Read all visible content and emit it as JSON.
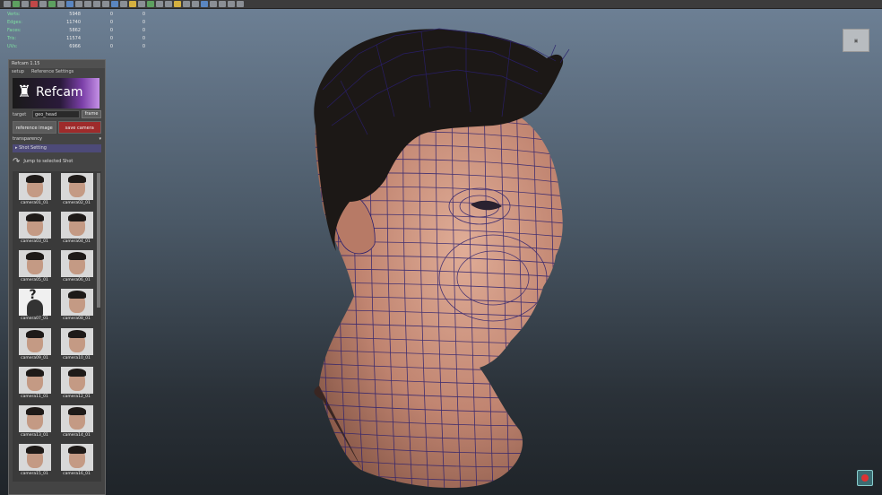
{
  "hud": {
    "rows": [
      {
        "label": "Verts:",
        "value": "5948",
        "a": "0",
        "b": "0"
      },
      {
        "label": "Edges:",
        "value": "11740",
        "a": "0",
        "b": "0"
      },
      {
        "label": "Faces:",
        "value": "5862",
        "a": "0",
        "b": "0"
      },
      {
        "label": "Tris:",
        "value": "11574",
        "a": "0",
        "b": "0"
      },
      {
        "label": "UVs:",
        "value": "6966",
        "a": "0",
        "b": "0"
      }
    ]
  },
  "panel": {
    "title": "Refcam 1.15",
    "menu": [
      "setup",
      "Reference Settings"
    ],
    "logo_text": "Refcam",
    "target_label": "target",
    "target_value": "geo_head",
    "frame_button": "frame",
    "reference_image_button": "reference image",
    "save_camera_button": "save camera",
    "transparency_label": "transparency",
    "shot_setting_label": "Shot Setting",
    "jump_label": "Jump to selected Shot",
    "thumbnails": [
      "camera01_01",
      "camera02_01",
      "camera03_01",
      "camera04_01",
      "camera05_01",
      "camera06_01",
      "camera07_01",
      "camera08_01",
      "camera09_01",
      "camera10_01",
      "camera11_01",
      "camera12_01",
      "camera13_01",
      "camera14_01",
      "camera15_01",
      "camera16_01"
    ]
  },
  "colors": {
    "accent_red": "#9e2b2b",
    "shot_header": "#4d4a78",
    "wire": "#2a1f6e",
    "skin": "#c8947c",
    "hair": "#1c1816"
  }
}
